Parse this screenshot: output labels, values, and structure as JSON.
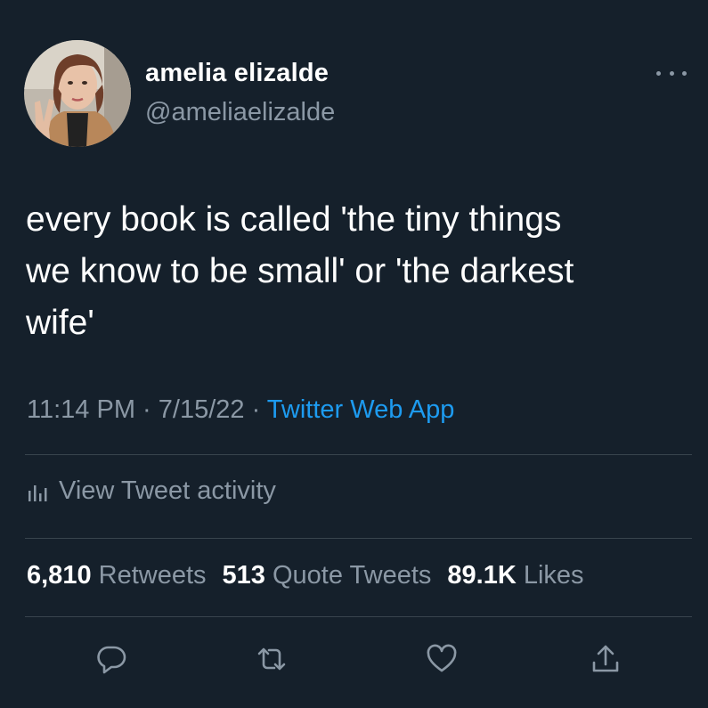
{
  "author": {
    "display_name": "amelia elizalde",
    "handle": "@ameliaelizalde"
  },
  "tweet": {
    "text": "every book is called 'the tiny things\nwe know to be small' or 'the darkest\nwife'",
    "time": "11:14 PM",
    "separator": " · ",
    "date": "7/15/22",
    "source": "Twitter Web App"
  },
  "activity": {
    "label": "View Tweet activity",
    "icon": "analytics-icon"
  },
  "stats": {
    "retweets_count": "6,810",
    "retweets_label": "Retweets",
    "quotes_count": "513",
    "quotes_label": "Quote Tweets",
    "likes_count": "89.1K",
    "likes_label": "Likes"
  },
  "actions": [
    "reply-icon",
    "retweet-icon",
    "like-icon",
    "share-icon"
  ],
  "colors": {
    "background": "#15202b",
    "text": "#ffffff",
    "secondary": "#8b98a5",
    "accent": "#1d9bf0",
    "divider": "#38444d"
  }
}
